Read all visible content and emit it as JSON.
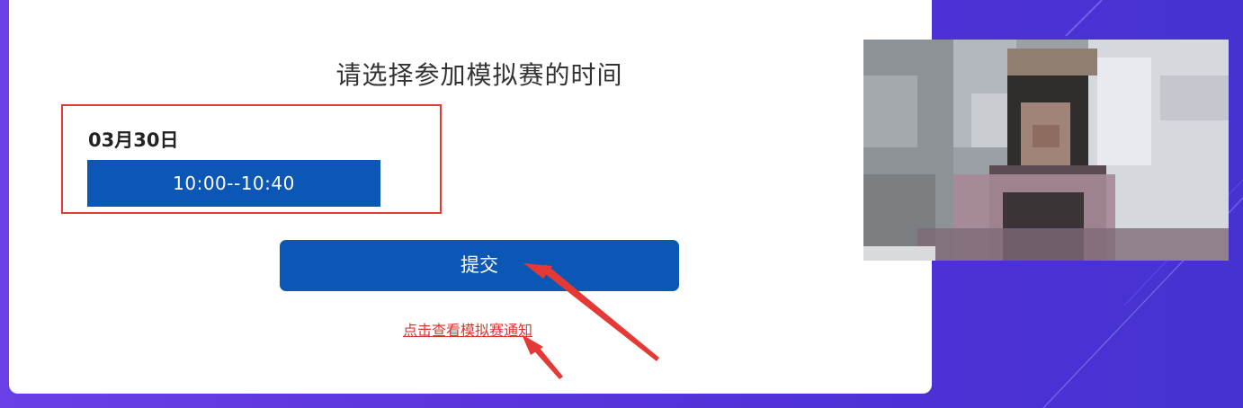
{
  "page": {
    "title": "请选择参加模拟赛的时间"
  },
  "schedule": {
    "date": "03月30日",
    "slots": [
      "10:00--10:40"
    ]
  },
  "actions": {
    "submit_label": "提交",
    "notice_link": "点击查看模拟赛通知"
  },
  "colors": {
    "primary": "#0a57b6",
    "highlight_border": "#e53935",
    "link": "#d9352f",
    "background": "#5a34dc"
  }
}
